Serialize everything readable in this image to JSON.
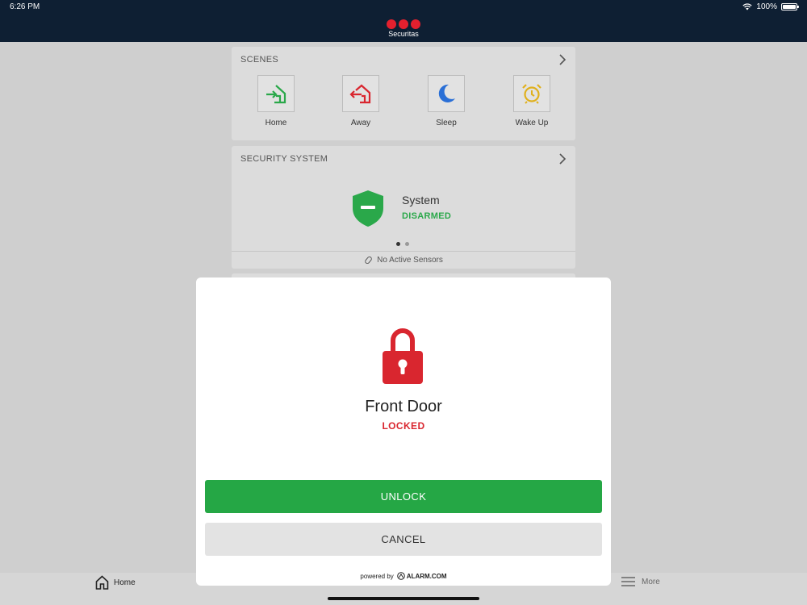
{
  "status_bar": {
    "time": "6:26 PM",
    "battery_text": "100%"
  },
  "header": {
    "brand": "Securitas"
  },
  "scenes": {
    "title": "SCENES",
    "items": [
      {
        "label": "Home",
        "icon": "home-arrive-icon",
        "color": "#2aa84a"
      },
      {
        "label": "Away",
        "icon": "home-leave-icon",
        "color": "#d9262f"
      },
      {
        "label": "Sleep",
        "icon": "moon-icon",
        "color": "#2a6fd6"
      },
      {
        "label": "Wake Up",
        "icon": "alarm-clock-icon",
        "color": "#e0b01c"
      }
    ]
  },
  "security_system": {
    "title": "SECURITY SYSTEM",
    "name": "System",
    "state": "DISARMED",
    "state_color": "#2aa84a",
    "sensors_text": "No Active Sensors"
  },
  "modal": {
    "device_name": "Front Door",
    "state": "LOCKED",
    "state_color": "#d9262f",
    "primary_button": "UNLOCK",
    "secondary_button": "CANCEL",
    "powered_by": "powered by",
    "powered_brand": "ALARM.COM"
  },
  "tabbar": {
    "home_label": "Home",
    "more_label": "More"
  }
}
